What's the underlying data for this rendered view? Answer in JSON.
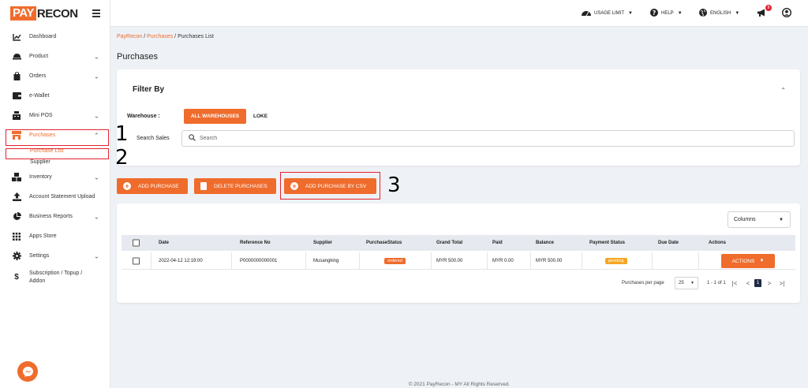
{
  "brand": {
    "pay": "PAY",
    "recon": "RECON"
  },
  "colors": {
    "accent": "#ef6c2c",
    "annotation_red": "#e3232e",
    "pager_active": "#1f2a44"
  },
  "topbar": {
    "usage_limit": "USAGE LIMIT",
    "help": "HELP",
    "language": "ENGLISH",
    "notification_count": "8"
  },
  "sidebar": {
    "items": [
      {
        "label": "Dashboard",
        "icon": "chart-line-icon"
      },
      {
        "label": "Product",
        "icon": "product-icon"
      },
      {
        "label": "Orders",
        "icon": "bag-icon"
      },
      {
        "label": "e-Wallet",
        "icon": "wallet-icon"
      },
      {
        "label": "Mini POS",
        "icon": "pos-icon"
      },
      {
        "label": "Purchases",
        "icon": "store-icon"
      },
      {
        "label": "Inventory",
        "icon": "boxes-icon"
      },
      {
        "label": "Account Statement Upload",
        "icon": "upload-icon"
      },
      {
        "label": "Business Reports",
        "icon": "pie-icon"
      },
      {
        "label": "Apps Store",
        "icon": "grid-icon"
      },
      {
        "label": "Settings",
        "icon": "gear-icon"
      },
      {
        "label": "Subscription / Topup / Addon",
        "label_line1": "Subscription / Topup /",
        "label_line2": "Addon",
        "icon": "dollar-icon"
      }
    ],
    "purchases_sub": [
      "Purchase List",
      "Supplier"
    ]
  },
  "breadcrumb": {
    "root": "PayRecon",
    "section": "Purchases",
    "current": "Purchases List"
  },
  "page_title": "Purchases",
  "filter": {
    "title": "Filter By",
    "warehouse_label": "Warehouse :",
    "warehouses": [
      "ALL WAREHOUSES",
      "LOKE"
    ],
    "search_label": "Search Sales",
    "search_placeholder": "Search"
  },
  "actions": {
    "add_purchase": "ADD PURCHASE",
    "delete_purchases": "DELETE PURCHASES",
    "add_purchase_csv": "ADD PURCHASE BY CSV"
  },
  "table": {
    "columns_label": "Columns",
    "headers": [
      "Date",
      "Reference No",
      "Supplier",
      "PurchaseStatus",
      "Grand Total",
      "Paid",
      "Balance",
      "Payment Status",
      "Due Date",
      "Actions"
    ],
    "rows": [
      {
        "date": "2022-04-12 12:19:00",
        "reference": "P0000000000001",
        "supplier": "Musangking",
        "purchase_status": "ordered",
        "grand_total": "MYR 500.00",
        "paid": "MYR 0.00",
        "balance": "MYR 500.00",
        "payment_status": "pending",
        "due_date": "",
        "action_label": "ACTIONS"
      }
    ]
  },
  "pagination": {
    "per_page_label": "Purchases per page",
    "per_page": "25",
    "range": "1 - 1 of 1",
    "current_page": "1"
  },
  "annotations": [
    "1",
    "2",
    "3"
  ],
  "footer": "© 2021 PayRecon - MY All Rights Reserved."
}
